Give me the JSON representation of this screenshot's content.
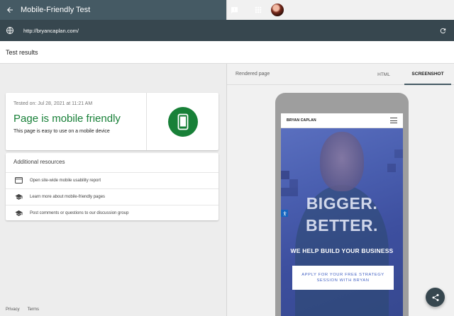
{
  "app": {
    "title": "Mobile-Friendly Test"
  },
  "url_bar": {
    "url": "http://bryancaplan.com/"
  },
  "results": {
    "label": "Test results"
  },
  "status_card": {
    "tested_on": "Tested on: Jul 28, 2021 at 11:21 AM",
    "headline": "Page is mobile friendly",
    "subtext": "This page is easy to use on a mobile device",
    "accent_color": "#188038"
  },
  "resources": {
    "title": "Additional resources",
    "items": [
      {
        "label": "Open site-wide mobile usability report",
        "icon": "report-icon"
      },
      {
        "label": "Learn more about mobile-friendly pages",
        "icon": "school-icon"
      },
      {
        "label": "Post comments or questions to our discussion group",
        "icon": "school-icon"
      }
    ]
  },
  "footer": {
    "privacy": "Privacy",
    "terms": "Terms"
  },
  "right_pane": {
    "rendered_label": "Rendered page",
    "tabs": [
      {
        "label": "HTML",
        "selected": false
      },
      {
        "label": "SCREENSHOT",
        "selected": true
      }
    ]
  },
  "preview": {
    "site_logo": "BRYAN CAPLAN",
    "hero_line1": "BIGGER.",
    "hero_line2": "BETTER.",
    "hero_line3": "WE HELP BUILD YOUR BUSINESS",
    "cta_line1": "APPLY FOR YOUR FREE STRATEGY",
    "cta_line2": "SESSION WITH BRYAN"
  },
  "colors": {
    "appbar": "#455a64",
    "urlbar": "#37474f",
    "success": "#188038"
  }
}
